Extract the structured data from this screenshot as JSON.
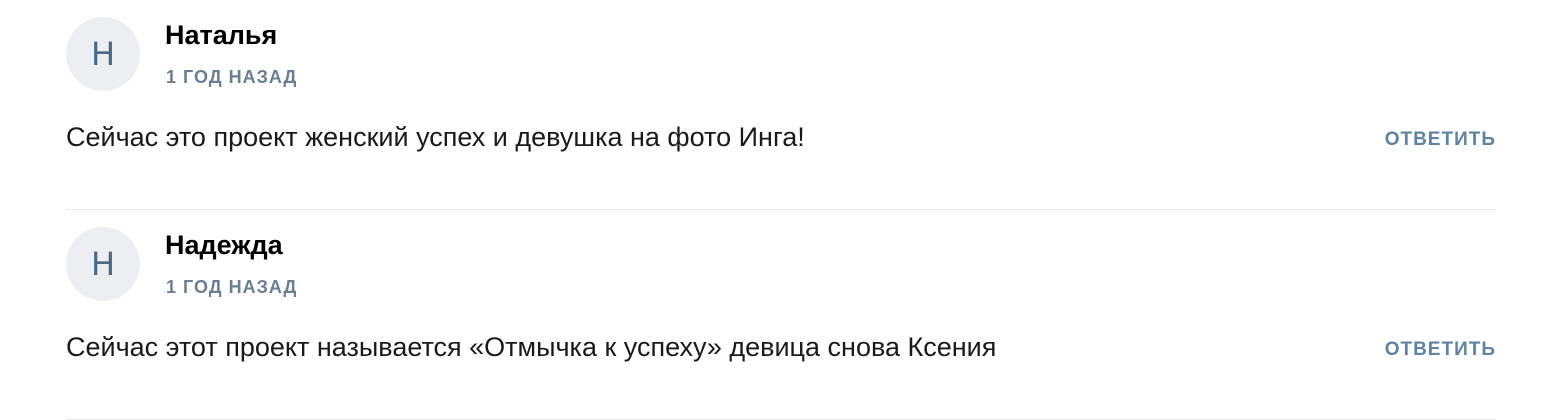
{
  "comments": [
    {
      "avatar_letter": "Н",
      "author": "Наталья",
      "time": "1 ГОД НАЗАД",
      "text": "Сейчас это проект женский успех и девушка на фото Инга!",
      "reply_label": "ОТВЕТИТЬ"
    },
    {
      "avatar_letter": "Н",
      "author": "Надежда",
      "time": "1 ГОД НАЗАД",
      "text": "Сейчас этот проект называется «Отмычка к успеху» девица снова Ксения",
      "reply_label": "ОТВЕТИТЬ"
    }
  ],
  "colors": {
    "avatar_bg": "#eceef1",
    "avatar_letter": "#4b6983",
    "time": "#6a7f92",
    "reply": "#5f83a3",
    "divider": "#e7e8ec"
  }
}
